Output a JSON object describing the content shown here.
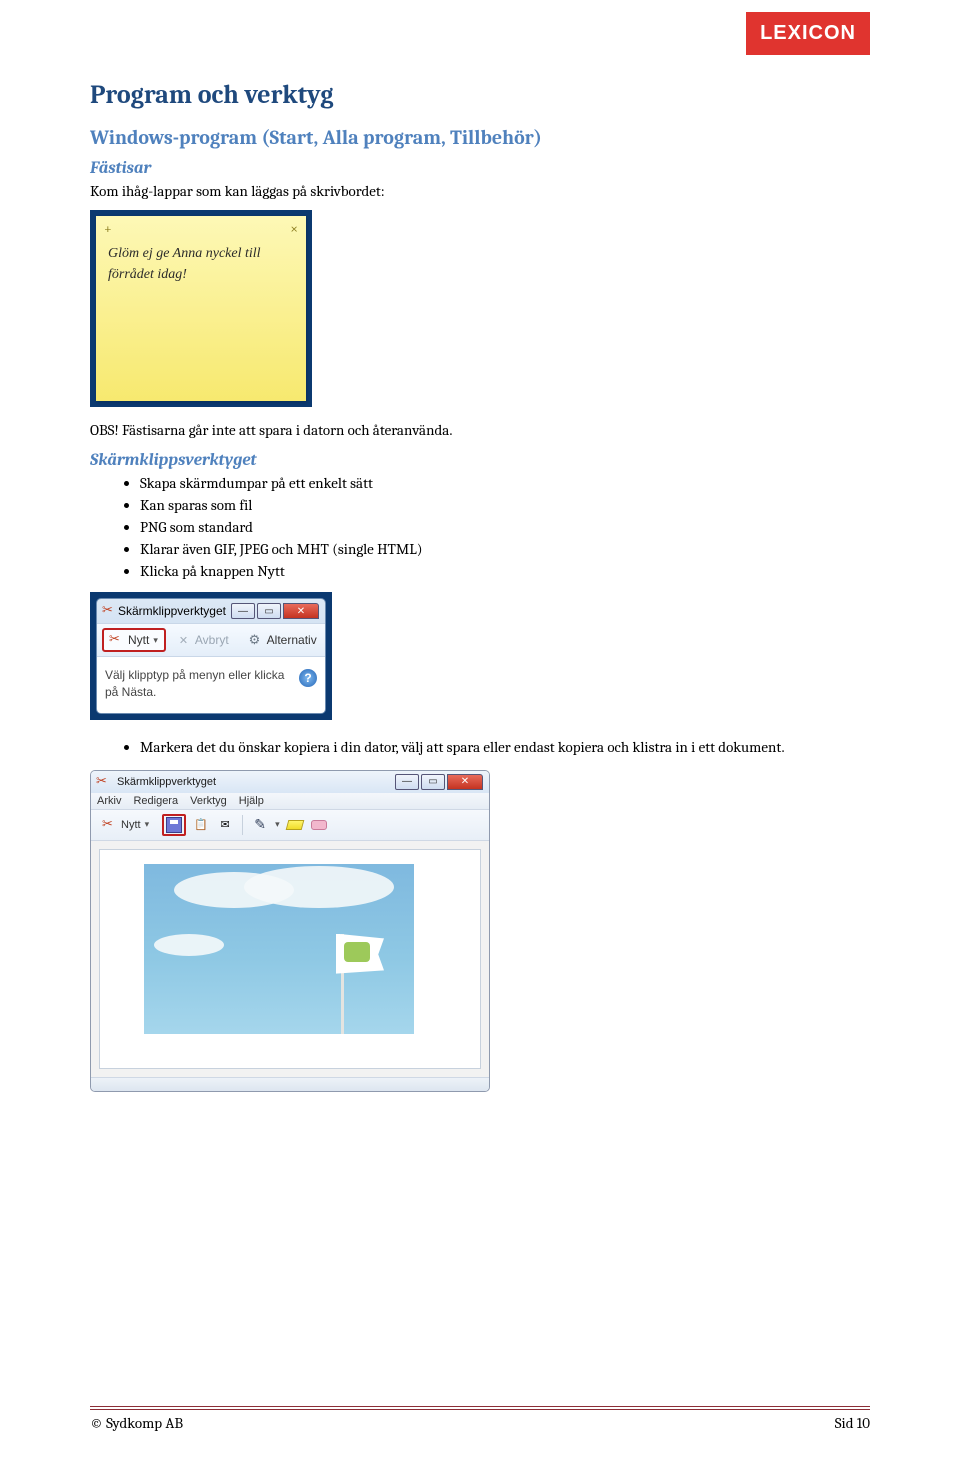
{
  "logo": "LEXICON",
  "heading": "Program och verktyg",
  "subheading": "Windows-program (Start, Alla program, Tillbehör)",
  "fastisar": {
    "title": "Fästisar",
    "intro": "Kom ihåg-lappar som kan läggas på skrivbordet:",
    "noteText": "Glöm ej ge Anna nyckel till förrådet idag!",
    "obs": "OBS! Fästisarna går inte att spara i datorn och återanvända."
  },
  "snip": {
    "title": "Skärmklippsverktyget",
    "bullets": [
      "Skapa skärmdumpar på ett enkelt sätt",
      "Kan sparas som fil",
      "PNG som standard",
      "Klarar även GIF, JPEG och MHT (single HTML)",
      "Klicka på knappen Nytt"
    ],
    "window": {
      "title": "Skärmklippverktyget",
      "newBtn": "Nytt",
      "cancelBtn": "Avbryt",
      "optionsBtn": "Alternativ",
      "hint": "Välj klipptyp på menyn eller klicka på Nästa."
    },
    "bullets2": [
      "Markera det du önskar kopiera i din dator, välj att spara eller endast kopiera och klistra in i ett dokument."
    ],
    "editor": {
      "title": "Skärmklippverktyget",
      "menu": [
        "Arkiv",
        "Redigera",
        "Verktyg",
        "Hjälp"
      ],
      "newBtn": "Nytt"
    }
  },
  "footer": {
    "left": "© Sydkomp AB",
    "right": "Sid 10"
  }
}
